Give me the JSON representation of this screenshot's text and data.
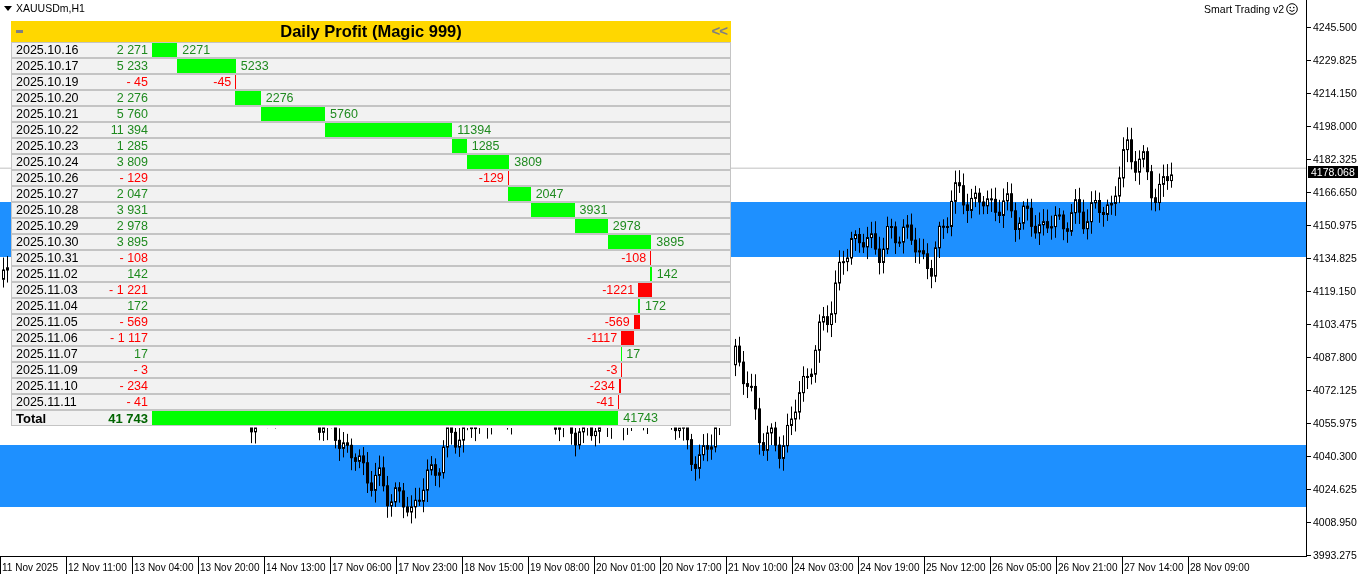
{
  "chart_header": {
    "symbol": "XAUUSDm,H1",
    "indicator": "Smart Trading v2"
  },
  "profit_panel": {
    "title": "Daily Profit (Magic 999)",
    "collapse_label": "<<",
    "rows": [
      {
        "date": "2025.10.16",
        "profit": "2 271",
        "bar_label": "2271"
      },
      {
        "date": "2025.10.17",
        "profit": "5 233",
        "bar_label": "5233"
      },
      {
        "date": "2025.10.19",
        "profit": "- 45",
        "bar_label": "-45"
      },
      {
        "date": "2025.10.20",
        "profit": "2 276",
        "bar_label": "2276"
      },
      {
        "date": "2025.10.21",
        "profit": "5 760",
        "bar_label": "5760"
      },
      {
        "date": "2025.10.22",
        "profit": "11 394",
        "bar_label": "11394"
      },
      {
        "date": "2025.10.23",
        "profit": "1 285",
        "bar_label": "1285"
      },
      {
        "date": "2025.10.24",
        "profit": "3 809",
        "bar_label": "3809"
      },
      {
        "date": "2025.10.26",
        "profit": "- 129",
        "bar_label": "-129"
      },
      {
        "date": "2025.10.27",
        "profit": "2 047",
        "bar_label": "2047"
      },
      {
        "date": "2025.10.28",
        "profit": "3 931",
        "bar_label": "3931"
      },
      {
        "date": "2025.10.29",
        "profit": "2 978",
        "bar_label": "2978"
      },
      {
        "date": "2025.10.30",
        "profit": "3 895",
        "bar_label": "3895"
      },
      {
        "date": "2025.10.31",
        "profit": "- 108",
        "bar_label": "-108"
      },
      {
        "date": "2025.11.02",
        "profit": "142",
        "bar_label": "142"
      },
      {
        "date": "2025.11.03",
        "profit": "- 1 221",
        "bar_label": "-1221"
      },
      {
        "date": "2025.11.04",
        "profit": "172",
        "bar_label": "172"
      },
      {
        "date": "2025.11.05",
        "profit": "- 569",
        "bar_label": "-569"
      },
      {
        "date": "2025.11.06",
        "profit": "- 1 117",
        "bar_label": "-1117"
      },
      {
        "date": "2025.11.07",
        "profit": "17",
        "bar_label": "17"
      },
      {
        "date": "2025.11.09",
        "profit": "- 3",
        "bar_label": "-3"
      },
      {
        "date": "2025.11.10",
        "profit": "- 234",
        "bar_label": "-234"
      },
      {
        "date": "2025.11.11",
        "profit": "- 41",
        "bar_label": "-41"
      }
    ],
    "total": {
      "label": "Total",
      "profit": "41 743",
      "bar_label": "41743"
    }
  },
  "price_axis": {
    "labels": [
      "4245.500",
      "4229.825",
      "4214.150",
      "4198.000",
      "4182.325",
      "4166.650",
      "4150.975",
      "4134.825",
      "4119.150",
      "4103.475",
      "4087.800",
      "4072.125",
      "4055.975",
      "4040.300",
      "4024.625",
      "4008.950",
      "3993.275"
    ],
    "current_price": "4178.068"
  },
  "time_axis": {
    "labels": [
      "11 Nov 2025",
      "12 Nov 11:00",
      "13 Nov 04:00",
      "13 Nov 20:00",
      "14 Nov 13:00",
      "17 Nov 06:00",
      "17 Nov 23:00",
      "18 Nov 15:00",
      "19 Nov 08:00",
      "20 Nov 01:00",
      "20 Nov 17:00",
      "21 Nov 10:00",
      "24 Nov 03:00",
      "24 Nov 19:00",
      "25 Nov 12:00",
      "26 Nov 05:00",
      "26 Nov 21:00",
      "27 Nov 14:00",
      "28 Nov 09:00"
    ]
  }
}
